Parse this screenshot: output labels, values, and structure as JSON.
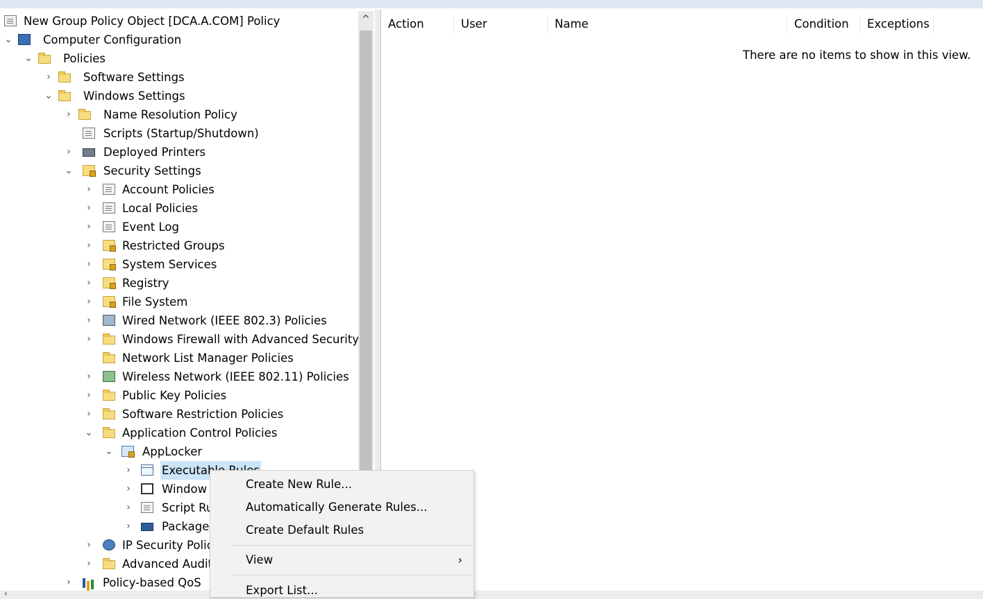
{
  "tree": {
    "root": "New Group Policy Object [DCA.A.COM] Policy",
    "computer_configuration": "Computer Configuration",
    "policies": "Policies",
    "software_settings": "Software Settings",
    "windows_settings": "Windows Settings",
    "name_resolution_policy": "Name Resolution Policy",
    "scripts": "Scripts (Startup/Shutdown)",
    "deployed_printers": "Deployed Printers",
    "security_settings": "Security Settings",
    "account_policies": "Account Policies",
    "local_policies": "Local Policies",
    "event_log": "Event Log",
    "restricted_groups": "Restricted Groups",
    "system_services": "System Services",
    "registry": "Registry",
    "file_system": "File System",
    "wired_network": "Wired Network (IEEE 802.3) Policies",
    "windows_firewall": "Windows Firewall with Advanced Security",
    "network_list_manager": "Network List Manager Policies",
    "wireless_network": "Wireless Network (IEEE 802.11) Policies",
    "public_key": "Public Key Policies",
    "software_restriction": "Software Restriction Policies",
    "application_control": "Application Control Policies",
    "applocker": "AppLocker",
    "executable_rules": "Executable Rules",
    "windows_installer_rules": "Window",
    "script_rules": "Script Ru",
    "packaged_app_rules": "Package",
    "ip_security": "IP Security Polic",
    "advanced_audit": "Advanced Audit",
    "policy_based_qos": "Policy-based QoS"
  },
  "list": {
    "columns": {
      "action": "Action",
      "user": "User",
      "name": "Name",
      "condition": "Condition",
      "exceptions": "Exceptions"
    },
    "empty_message": "There are no items to show in this view."
  },
  "context_menu": {
    "create_new_rule": "Create New Rule...",
    "auto_generate": "Automatically Generate Rules...",
    "create_default": "Create Default Rules",
    "view": "View",
    "export_list": "Export List..."
  },
  "icons": {
    "chevron_expanded": "chevron-down-icon",
    "chevron_collapsed": "chevron-right-icon",
    "submenu_arrow": "chevron-right-icon"
  },
  "colors": {
    "selection": "#cce4f7",
    "menu_background": "#f2f2f2",
    "folder": "#f7dc80"
  }
}
